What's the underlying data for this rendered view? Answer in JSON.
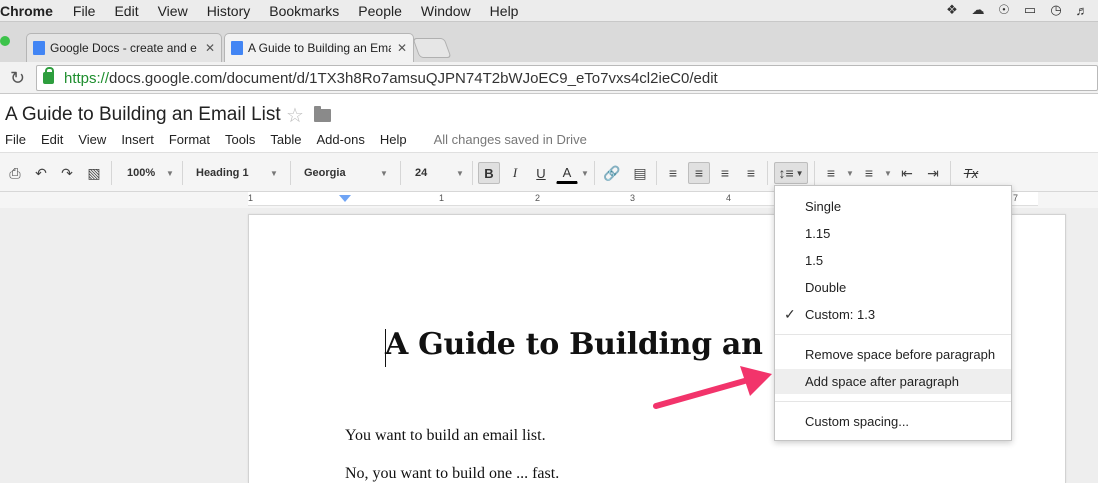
{
  "mac_menubar": {
    "app": "Chrome",
    "items": [
      "File",
      "Edit",
      "View",
      "History",
      "Bookmarks",
      "People",
      "Window",
      "Help"
    ],
    "tray_icons": [
      "dropbox-icon",
      "cloud-icon",
      "onepassword-icon",
      "airplay-icon",
      "time-machine-icon",
      "volume-icon"
    ]
  },
  "tabs": [
    {
      "title": "Google Docs - create and e",
      "active": false
    },
    {
      "title": "A Guide to Building an Ema",
      "active": true
    }
  ],
  "address": {
    "scheme": "https://",
    "rest": "docs.google.com/document/d/1TX3h8Ro7amsuQJPN74T2bWJoEC9_eTo7vxs4cl2ieC0/edit"
  },
  "doc": {
    "title": "A Guide to Building an Email List",
    "menu": [
      "File",
      "Edit",
      "View",
      "Insert",
      "Format",
      "Tools",
      "Table",
      "Add-ons",
      "Help"
    ],
    "save_status": "All changes saved in Drive"
  },
  "toolbar": {
    "zoom": "100%",
    "style": "Heading 1",
    "font": "Georgia",
    "size": "24",
    "bold": "B",
    "italic": "I",
    "underline": "U",
    "text_color": "A",
    "clear_format": "Tx"
  },
  "ruler": {
    "marks": [
      "1",
      "1",
      "2",
      "3",
      "4",
      "7"
    ]
  },
  "page": {
    "heading": "A Guide to Building an E",
    "paragraphs": [
      "You want to build an email list.",
      "No, you want to build one ... fast."
    ]
  },
  "line_spacing_menu": {
    "options": [
      "Single",
      "1.15",
      "1.5",
      "Double",
      "Custom: 1.3"
    ],
    "checked": "Custom: 1.3",
    "paragraph_options": [
      "Remove space before paragraph",
      "Add space after paragraph"
    ],
    "highlighted": "Add space after paragraph",
    "custom": "Custom spacing..."
  },
  "colors": {
    "accent_arrow": "#f2346b",
    "https_green": "#1e8e2e",
    "doc_icon_blue": "#4285f4"
  }
}
